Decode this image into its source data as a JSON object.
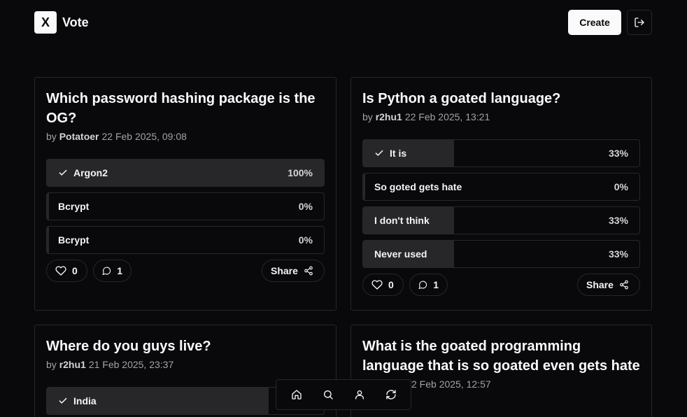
{
  "header": {
    "logo_letter": "X",
    "app_name": "Vote",
    "create_label": "Create"
  },
  "polls": [
    {
      "title": "Which password hashing package is the OG?",
      "author": "Potatoer",
      "date": "22 Feb 2025, 09:08",
      "options": [
        {
          "label": "Argon2",
          "percent": "100%",
          "fraction": 1.0,
          "checked": true
        },
        {
          "label": "Bcrypt",
          "percent": "0%",
          "fraction": 0.0,
          "checked": false
        },
        {
          "label": "Bcrypt",
          "percent": "0%",
          "fraction": 0.0,
          "checked": false
        }
      ],
      "likes": "0",
      "comments": "1",
      "share_label": "Share"
    },
    {
      "title": "Is Python a goated language?",
      "author": "r2hu1",
      "date": "22 Feb 2025, 13:21",
      "options": [
        {
          "label": "It is",
          "percent": "33%",
          "fraction": 0.33,
          "checked": true
        },
        {
          "label": "So goted gets hate",
          "percent": "0%",
          "fraction": 0.0,
          "checked": false
        },
        {
          "label": "I don't think",
          "percent": "33%",
          "fraction": 0.33,
          "checked": false
        },
        {
          "label": "Never used",
          "percent": "33%",
          "fraction": 0.33,
          "checked": false
        }
      ],
      "likes": "0",
      "comments": "1",
      "share_label": "Share"
    },
    {
      "title": "Where do you guys live?",
      "author": "r2hu1",
      "date": "21 Feb 2025, 23:37",
      "options": [
        {
          "label": "India",
          "percent": "",
          "fraction": 0.8,
          "checked": true
        }
      ]
    },
    {
      "title": "What is the goated programming language that is so goated even gets hate",
      "date": "2 Feb 2025, 12:57"
    }
  ],
  "bottom_nav": [
    "home-icon",
    "search-icon",
    "user-icon",
    "refresh-icon"
  ]
}
